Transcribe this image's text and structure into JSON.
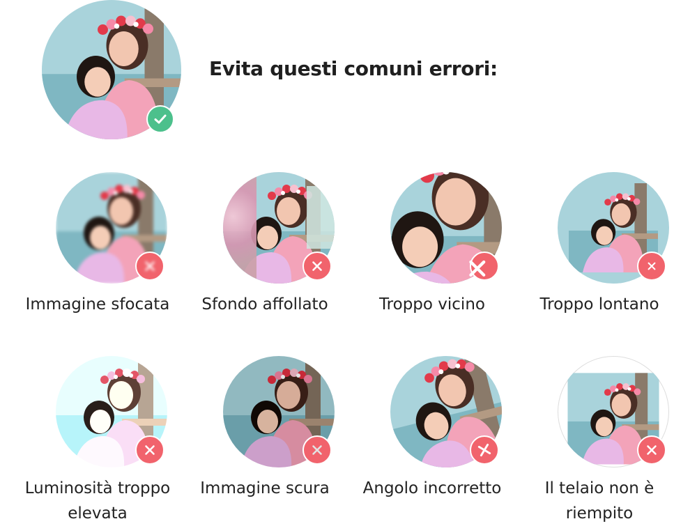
{
  "header": {
    "title": "Evita questi comuni errori:"
  },
  "hero": {
    "badge_icon": "check-icon",
    "badge_color": "#4cc08c"
  },
  "errors": [
    {
      "label": "Immagine sfocata",
      "icon": "close-icon"
    },
    {
      "label": "Sfondo affollato",
      "icon": "close-icon"
    },
    {
      "label": "Troppo vicino",
      "icon": "close-icon"
    },
    {
      "label": "Troppo lontano",
      "icon": "close-icon"
    },
    {
      "label": "Luminosità troppo elevata",
      "icon": "close-icon"
    },
    {
      "label": "Immagine scura",
      "icon": "close-icon"
    },
    {
      "label": "Angolo incorretto",
      "icon": "close-icon"
    },
    {
      "label": "Il telaio non è riempito",
      "icon": "close-icon"
    }
  ],
  "colors": {
    "error_badge": "#f1636c",
    "ok_badge": "#4cc08c"
  }
}
